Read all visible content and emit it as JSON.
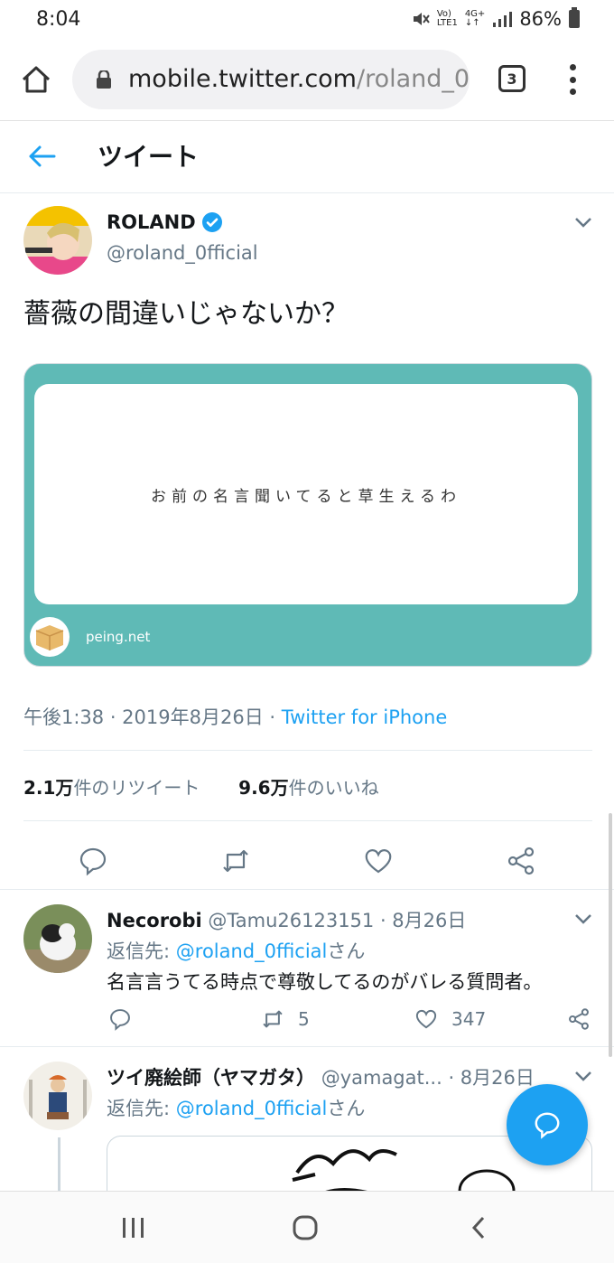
{
  "status_bar": {
    "time": "8:04",
    "net_top": "Vo)",
    "net_bottom": "LTE1",
    "net2_top": "4G+",
    "battery": "86%"
  },
  "browser": {
    "url_host": "mobile.twitter.com",
    "url_path": "/roland_0",
    "tab_count": "3"
  },
  "header": {
    "title": "ツイート"
  },
  "tweet": {
    "name": "ROLAND",
    "handle": "@roland_0fficial",
    "text": "薔薇の間違いじゃないか？",
    "card_quote": "お前の名言聞いてると草生えるわ",
    "card_site": "peing.net",
    "time": "午後1:38 · 2019年8月26日 · ",
    "source": "Twitter for iPhone",
    "retweets_count": "2.1万",
    "retweets_label": "件のリツイート",
    "likes_count": "9.6万",
    "likes_label": "件のいいね"
  },
  "replies": [
    {
      "name": "Necorobi",
      "handle": "@Tamu26123151",
      "date": " · 8月26日",
      "reply_prefix": "返信先: ",
      "reply_to": "@roland_0fficial",
      "reply_suffix": "さん",
      "text": "名言言うてる時点で尊敬してるのがバレる質問者。",
      "retweets": "5",
      "likes": "347"
    },
    {
      "name": "ツイ廃絵師（ヤマガタ）",
      "handle": "@yamagat...",
      "date": " · 8月26日",
      "reply_prefix": "返信先: ",
      "reply_to": "@roland_0fficial",
      "reply_suffix": "さん"
    }
  ],
  "colors": {
    "accent": "#1da1f2",
    "card_bg": "#5fbab6",
    "muted": "#657786"
  }
}
